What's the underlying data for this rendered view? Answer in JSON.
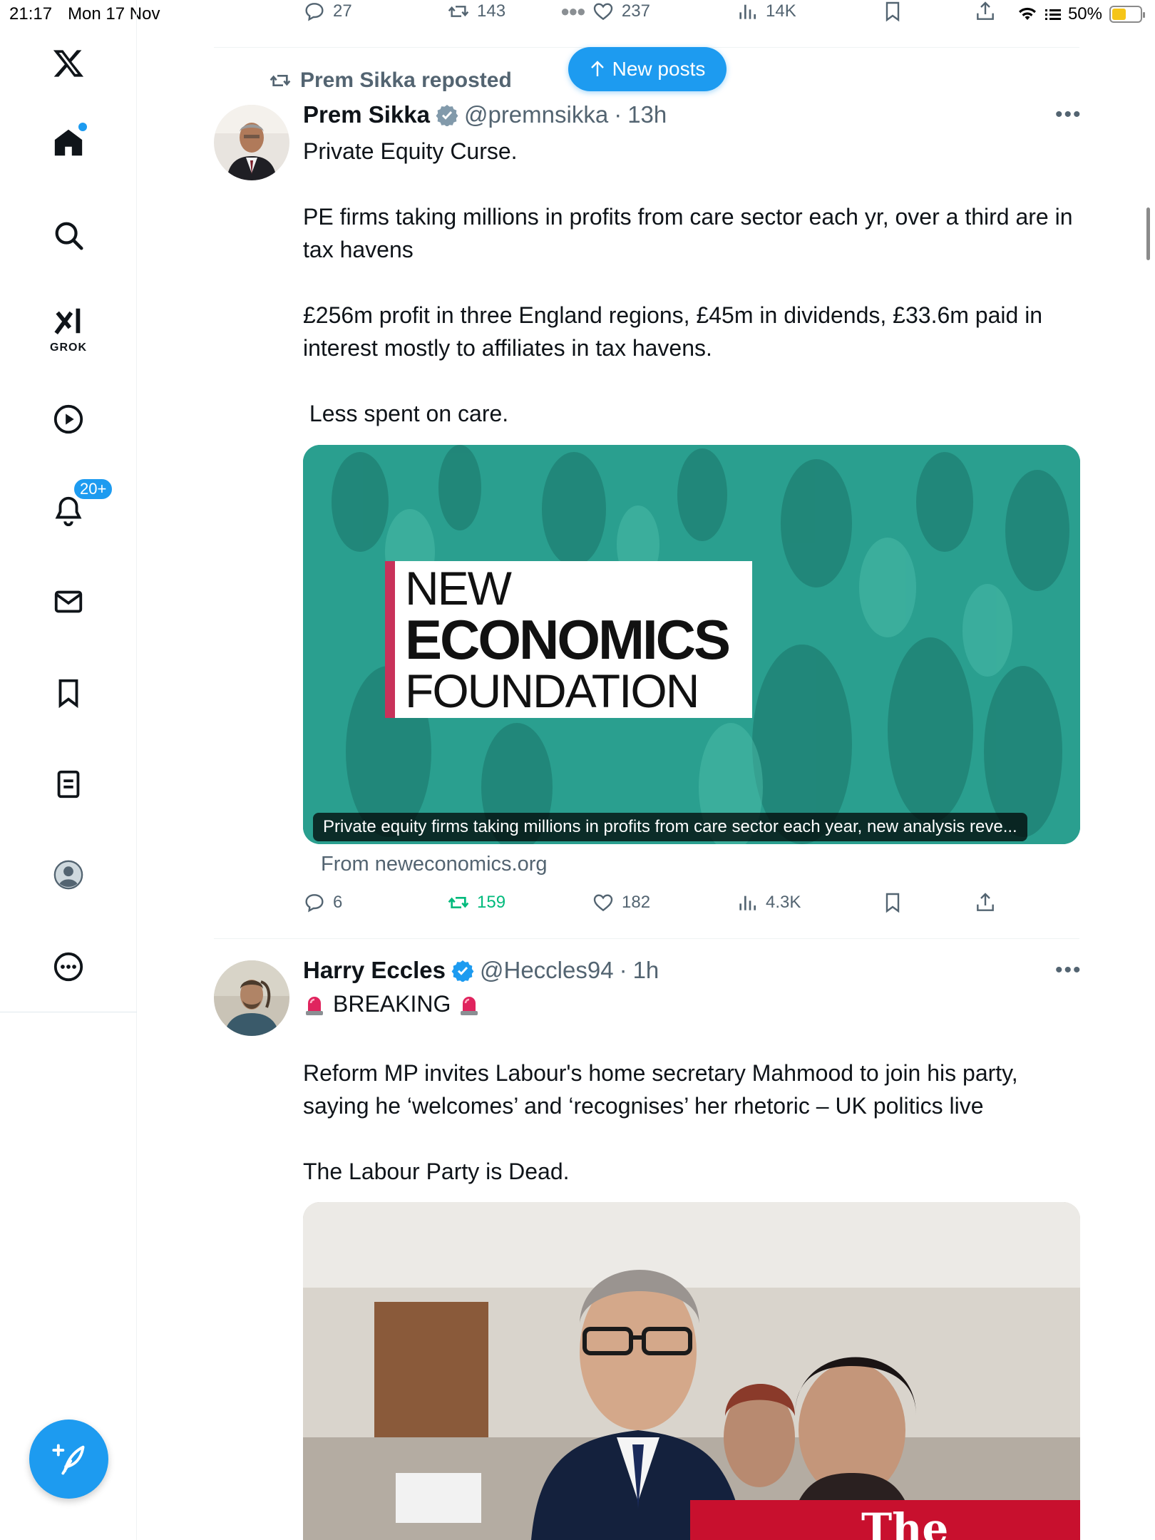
{
  "status_bar": {
    "time": "21:17",
    "date": "Mon 17 Nov",
    "battery": "50%"
  },
  "sidebar": {
    "grok_label": "GROK",
    "notifications_badge": "20+",
    "items": [
      "x-logo",
      "home",
      "search",
      "grok",
      "videos",
      "notifications",
      "messages",
      "bookmarks",
      "lists",
      "profile",
      "more"
    ]
  },
  "top_metrics": {
    "replies": "27",
    "reposts": "143",
    "likes": "237",
    "views": "14K"
  },
  "new_posts": {
    "label": "New posts"
  },
  "tweet1": {
    "repost_label": "Prem Sikka reposted",
    "name": "Prem Sikka",
    "handle": "@premnsikka",
    "time": "13h",
    "text": {
      "p1": "Private Equity Curse.",
      "p2": "PE firms taking millions in profits from care sector each yr, over a third are in tax havens",
      "p3": "£256m profit in three England regions, £45m in dividends, £33.6m paid in interest mostly to affiliates in tax havens.",
      "p4": " Less spent on care."
    },
    "card": {
      "logo_line1": "NEW",
      "logo_line2": "ECONOMICS",
      "logo_line3": "FOUNDATION",
      "caption": "Private equity firms taking millions in profits from care sector each year, new analysis reve...",
      "source": "From neweconomics.org"
    },
    "metrics": {
      "replies": "6",
      "reposts": "159",
      "likes": "182",
      "views": "4.3K"
    }
  },
  "tweet2": {
    "name": "Harry Eccles",
    "handle": "@Heccles94",
    "time": "1h",
    "breaking": "BREAKING",
    "text": {
      "p1": "Reform MP invites Labour's home secretary Mahmood to join his party, saying he ‘welcomes’ and ‘recognises’ her rhetoric – UK politics live",
      "p2": "The Labour Party is Dead."
    },
    "photo_banner": "The"
  },
  "colors": {
    "accent": "#1d9bf0",
    "repost_green": "#00ba7c",
    "text": "#0f1419",
    "muted": "#536471",
    "card_teal": "#2aa191"
  }
}
